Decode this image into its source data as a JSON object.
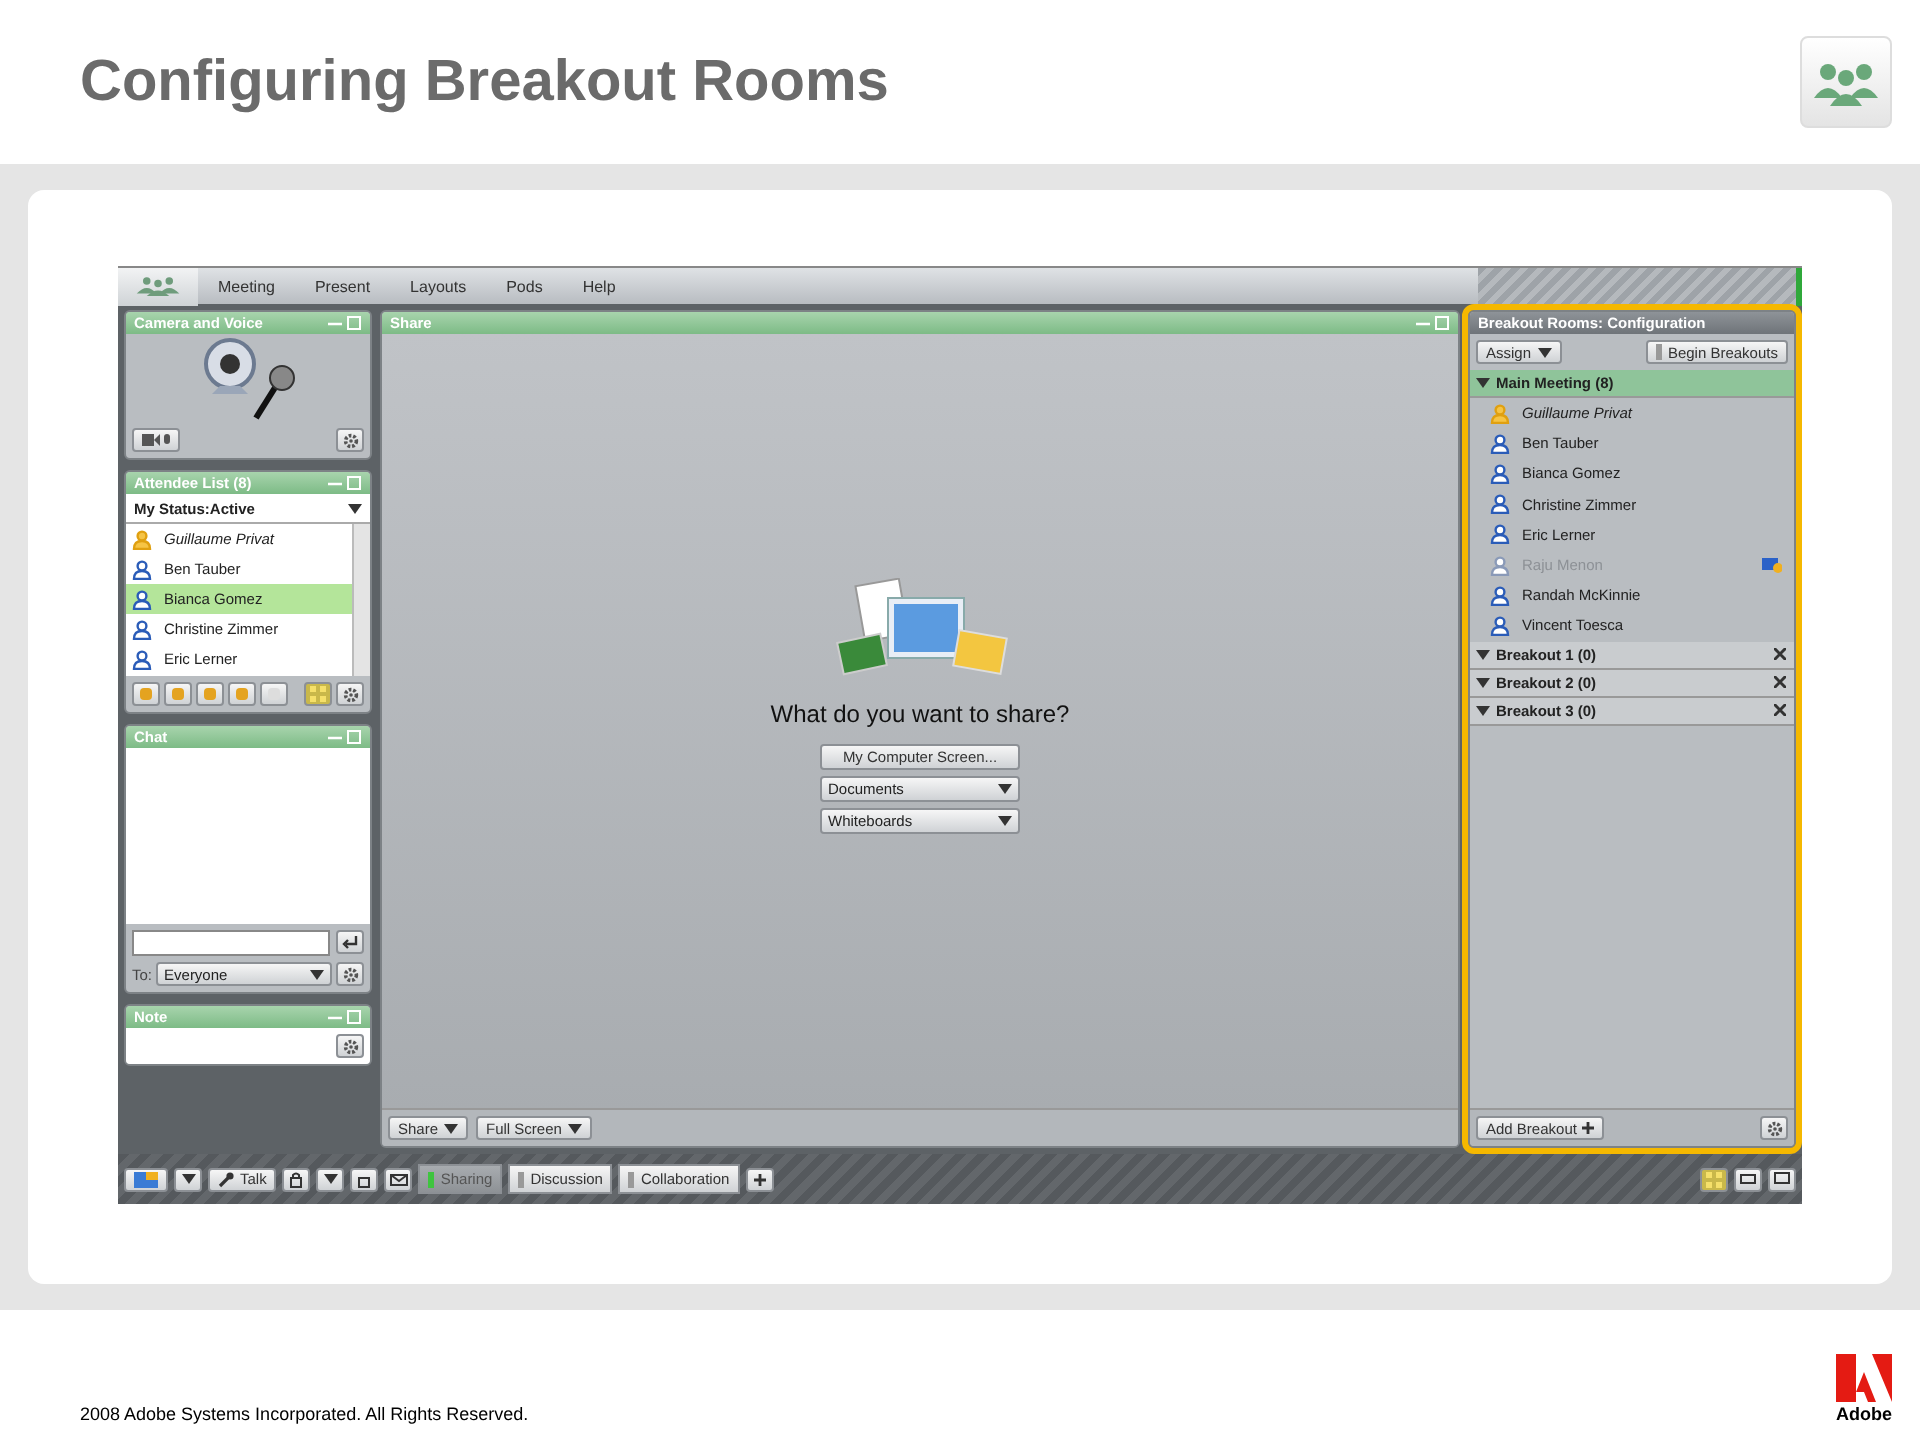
{
  "slide": {
    "title": "Configuring Breakout Rooms",
    "copyright": "2008 Adobe Systems Incorporated. All Rights Reserved.",
    "brand": "Adobe"
  },
  "menu": [
    "Meeting",
    "Present",
    "Layouts",
    "Pods",
    "Help"
  ],
  "camera_pod": {
    "title": "Camera and Voice"
  },
  "attendee_pod": {
    "title": "Attendee List (8)",
    "status": "My Status:Active",
    "attendees": [
      {
        "name": "Guillaume Privat",
        "host": true,
        "selected": false
      },
      {
        "name": "Ben Tauber",
        "host": false,
        "selected": false
      },
      {
        "name": "Bianca Gomez",
        "host": false,
        "selected": true
      },
      {
        "name": "Christine Zimmer",
        "host": false,
        "selected": false
      },
      {
        "name": "Eric Lerner",
        "host": false,
        "selected": false
      }
    ]
  },
  "chat_pod": {
    "title": "Chat",
    "to_label": "To:",
    "recipient": "Everyone"
  },
  "note_pod": {
    "title": "Note"
  },
  "share_pod": {
    "title": "Share",
    "prompt": "What do you want to share?",
    "options": [
      {
        "label": "My Computer Screen...",
        "kind": "button"
      },
      {
        "label": "Documents",
        "kind": "dropdown"
      },
      {
        "label": "Whiteboards",
        "kind": "dropdown"
      }
    ],
    "footer_buttons": [
      "Share",
      "Full Screen"
    ]
  },
  "bottom_bar": {
    "talk": "Talk",
    "layouts": [
      {
        "label": "Sharing",
        "selected": true
      },
      {
        "label": "Discussion",
        "selected": false
      },
      {
        "label": "Collaboration",
        "selected": false
      }
    ]
  },
  "breakout_pod": {
    "title": "Breakout Rooms: Configuration",
    "assign": "Assign",
    "begin": "Begin Breakouts",
    "add": "Add Breakout",
    "rooms": [
      {
        "name": "Main Meeting (8)",
        "kind": "main",
        "selected": true,
        "attendees": [
          {
            "name": "Guillaume Privat",
            "host": true,
            "disabled": false
          },
          {
            "name": "Ben Tauber",
            "host": false,
            "disabled": false
          },
          {
            "name": "Bianca Gomez",
            "host": false,
            "disabled": false
          },
          {
            "name": "Christine Zimmer",
            "host": false,
            "disabled": false
          },
          {
            "name": "Eric Lerner",
            "host": false,
            "disabled": false
          },
          {
            "name": "Raju Menon",
            "host": false,
            "disabled": true
          },
          {
            "name": "Randah McKinnie",
            "host": false,
            "disabled": false
          },
          {
            "name": "Vincent Toesca",
            "host": false,
            "disabled": false
          }
        ]
      },
      {
        "name": "Breakout 1 (0)",
        "kind": "breakout",
        "selected": false
      },
      {
        "name": "Breakout 2 (0)",
        "kind": "breakout",
        "selected": false
      },
      {
        "name": "Breakout 3 (0)",
        "kind": "breakout",
        "selected": false
      }
    ]
  }
}
